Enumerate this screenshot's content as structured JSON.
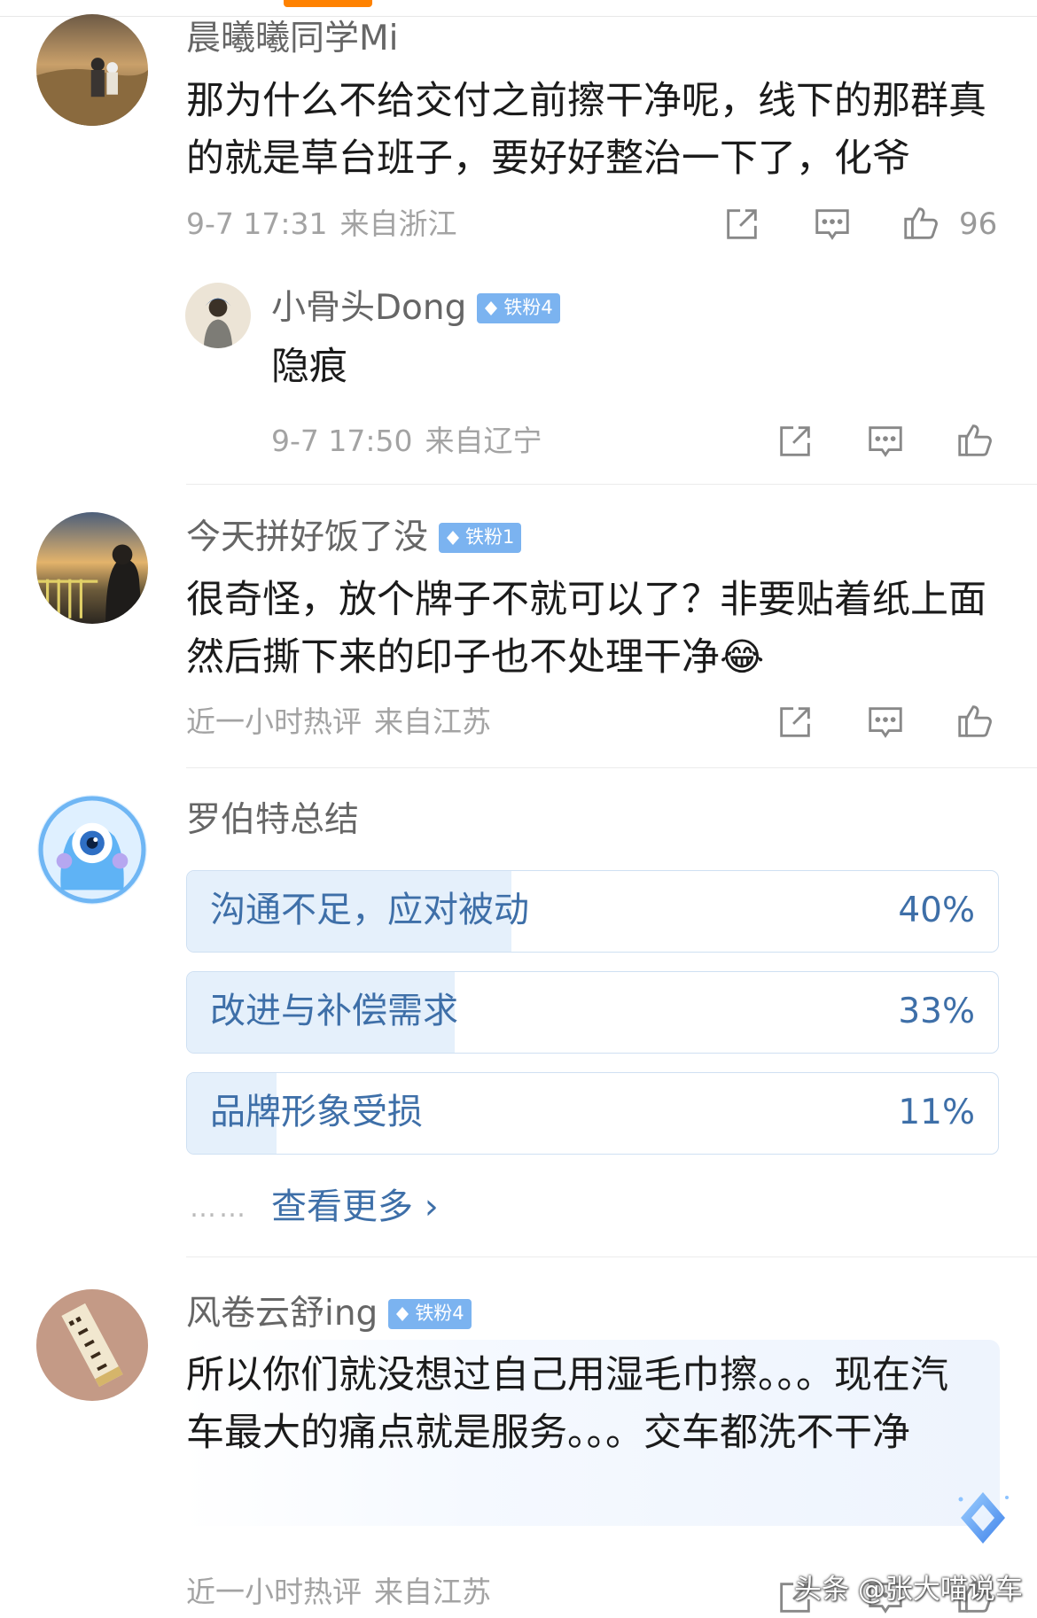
{
  "comments": [
    {
      "username": "晨曦曦同学Mi",
      "text": "那为什么不给交付之前擦干净呢，线下的那群真的就是草台班子，要好好整治一下了，化爷",
      "time": "9-7 17:31",
      "location": "来自浙江",
      "like_count": "96"
    },
    {
      "username": "小骨头Dong",
      "badge": "铁粉4",
      "text": "隐痕",
      "time": "9-7 17:50",
      "location": "来自辽宁"
    },
    {
      "username": "今天拼好饭了没",
      "badge": "铁粉1",
      "text": "很奇怪，放个牌子不就可以了？非要贴着纸上面然后撕下来的印子也不处理干净",
      "emoji": "😂",
      "time": "近一小时热评",
      "location": "来自江苏"
    },
    {
      "username": "风卷云舒ing",
      "badge": "铁粉4",
      "text": "所以你们就没想过自己用湿毛巾擦。。。现在汽车最大的痛点就是服务。。。交车都洗不干净",
      "time": "近一小时热评",
      "location": "来自江苏"
    }
  ],
  "summary": {
    "title": "罗伯特总结",
    "options": [
      {
        "label": "沟通不足，应对被动",
        "percent": "40%",
        "fraction": 0.4
      },
      {
        "label": "改进与补偿需求",
        "percent": "33%",
        "fraction": 0.33
      },
      {
        "label": "品牌形象受损",
        "percent": "11%",
        "fraction": 0.11
      }
    ],
    "more_dots": "……",
    "more_label": "查看更多 ›"
  },
  "watermark": "头条 @张大喵说车",
  "colors": {
    "accent_blue": "#3e6fa8",
    "badge_blue": "#7bb3f0",
    "tab_orange": "#ff8200",
    "meta_gray": "#a3a3a3"
  },
  "icons": [
    "share-icon",
    "comment-icon",
    "like-icon",
    "diamond-icon"
  ]
}
